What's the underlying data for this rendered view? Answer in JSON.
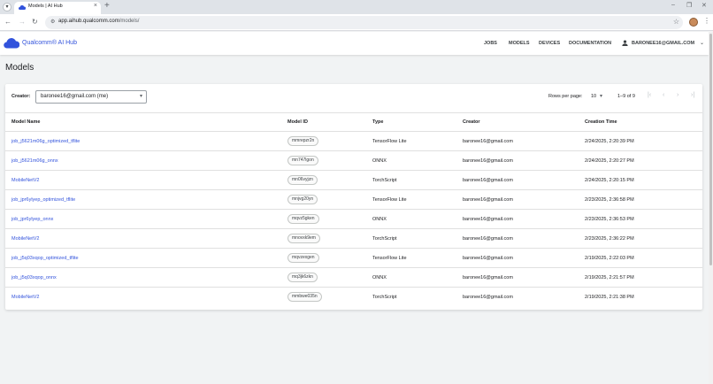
{
  "browser": {
    "tab_title": "Models | AI Hub",
    "url_host": "app.aihub.qualcomm.com",
    "url_path": "/models/",
    "new_tab": "+",
    "tab_close": "×"
  },
  "app": {
    "brand": "Qualcomm® AI Hub",
    "nav": [
      "JOBS",
      "MODELS",
      "DEVICES",
      "DOCUMENTATION"
    ],
    "user_email": "BARONEE16@GMAIL.COM",
    "page_title": "Models"
  },
  "filters": {
    "creator_label": "Creator:",
    "creator_value": "baronee16@gmail.com (me)"
  },
  "pagination": {
    "rows_per_page_label": "Rows per page:",
    "rows_per_page_value": "10",
    "range": "1–9 of 9"
  },
  "table": {
    "columns": [
      "Model Name",
      "Model ID",
      "Type",
      "Creator",
      "Creation Time"
    ],
    "rows": [
      {
        "name": "job_j5621m06g_optimized_tflite",
        "id": "mmrepzr2n",
        "type": "TensorFlow Lite",
        "creator": "baronee16@gmail.com",
        "time": "2/24/2025, 2:20:39 PM"
      },
      {
        "name": "job_j5621m06g_onnx",
        "id": "mn747lgon",
        "type": "ONNX",
        "creator": "baronee16@gmail.com",
        "time": "2/24/2025, 2:20:27 PM"
      },
      {
        "name": "MobileNetV2",
        "id": "mn06vyjzn",
        "type": "TorchScript",
        "creator": "baronee16@gmail.com",
        "time": "2/24/2025, 2:20:15 PM"
      },
      {
        "name": "job_jpr6ylyep_optimized_tflite",
        "id": "mnjvg20yn",
        "type": "TensorFlow Lite",
        "creator": "baronee16@gmail.com",
        "time": "2/23/2025, 2:36:58 PM"
      },
      {
        "name": "job_jpr6ylyep_onnx",
        "id": "mqvz5gken",
        "type": "ONNX",
        "creator": "baronee16@gmail.com",
        "time": "2/23/2025, 2:36:53 PM"
      },
      {
        "name": "MobileNetV2",
        "id": "mnovxk9em",
        "type": "TorchScript",
        "creator": "baronee16@gmail.com",
        "time": "2/23/2025, 2:36:22 PM"
      },
      {
        "name": "job_j5q03xqop_optimized_tflite",
        "id": "mqvzexgen",
        "type": "TensorFlow Lite",
        "creator": "baronee16@gmail.com",
        "time": "2/19/2025, 2:22:03 PM"
      },
      {
        "name": "job_j5q03xqop_onnx",
        "id": "mq3jk6zkn",
        "type": "ONNX",
        "creator": "baronee16@gmail.com",
        "time": "2/19/2025, 2:21:57 PM"
      },
      {
        "name": "MobileNetV2",
        "id": "mmbwe035n",
        "type": "TorchScript",
        "creator": "baronee16@gmail.com",
        "time": "2/19/2025, 2:21:38 PM"
      }
    ]
  }
}
